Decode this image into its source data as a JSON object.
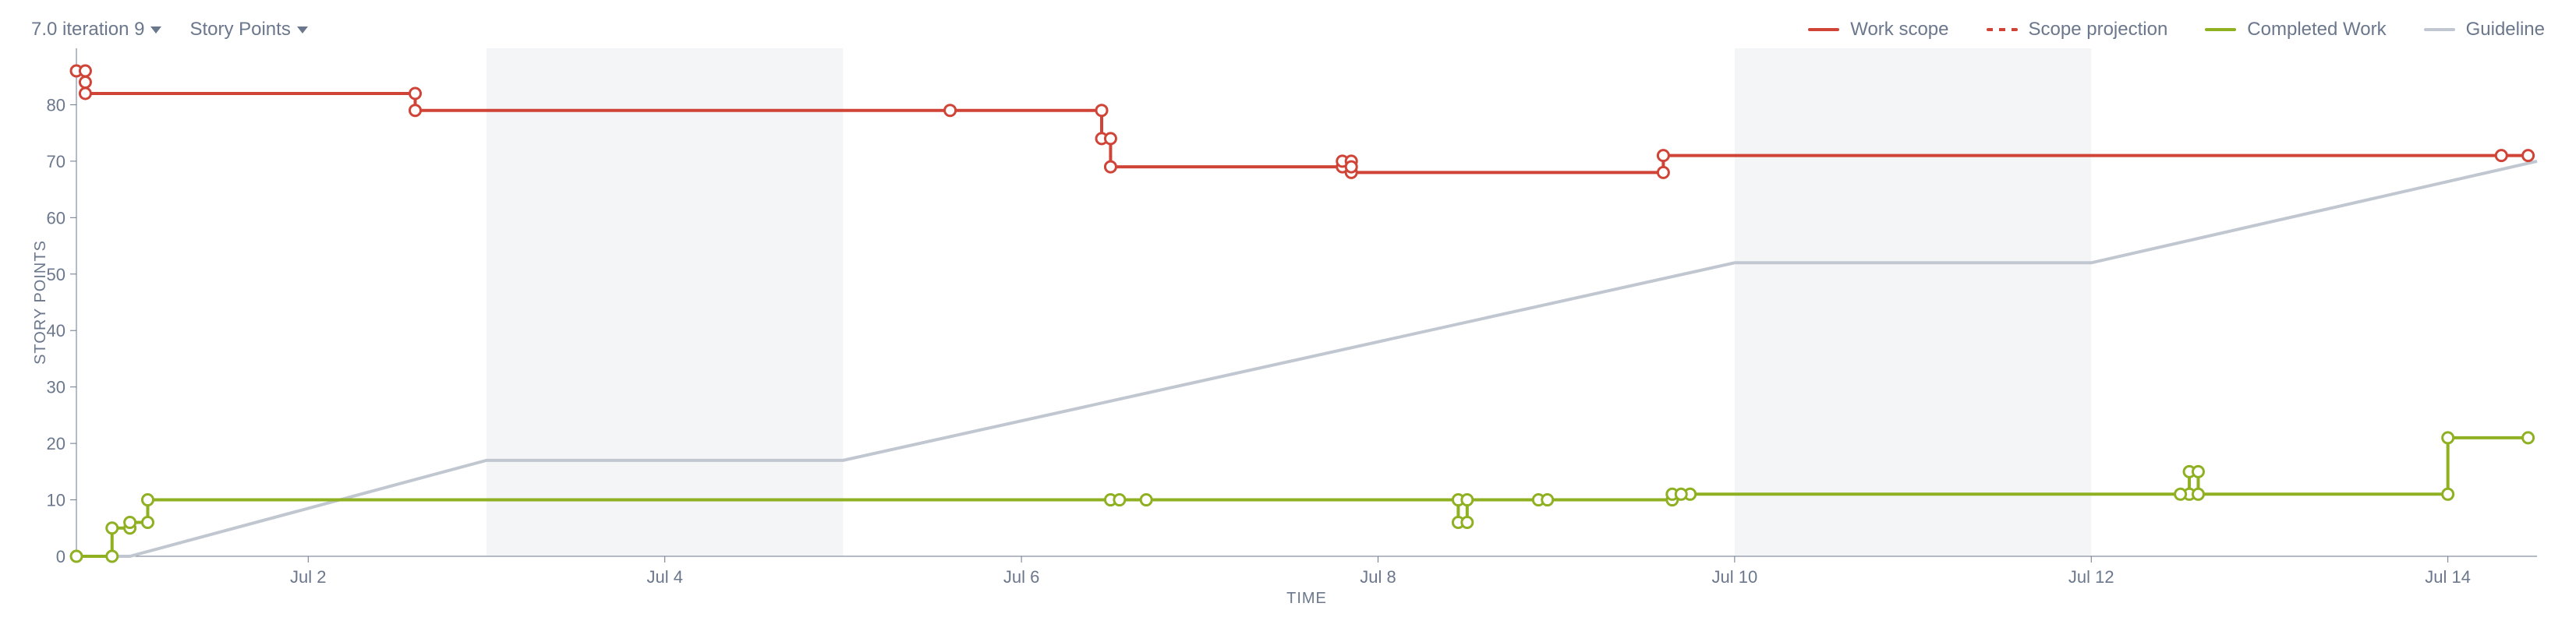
{
  "controls": {
    "sprint_dd_label": "7.0 iteration 9",
    "metric_dd_label": "Story Points"
  },
  "legend": {
    "work_scope": "Work scope",
    "scope_projection": "Scope projection",
    "completed_work": "Completed Work",
    "guideline": "Guideline"
  },
  "axes": {
    "x_title": "TIME",
    "y_title": "STORY POINTS"
  },
  "colors": {
    "red": "#d04437",
    "green": "#8eb021",
    "grey": "#c1c7d0",
    "weekend": "#f4f5f7",
    "text": "#6b778c"
  },
  "chart_data": {
    "type": "line",
    "xlabel": "TIME",
    "ylabel": "STORY POINTS",
    "ylim": [
      0,
      90
    ],
    "y_ticks": [
      0,
      10,
      20,
      30,
      40,
      50,
      60,
      70,
      80
    ],
    "x_range": [
      0.7,
      14.5
    ],
    "x_tick_positions": [
      2,
      4,
      6,
      8,
      10,
      12,
      14
    ],
    "x_tick_labels": [
      "Jul 2",
      "Jul 4",
      "Jul 6",
      "Jul 8",
      "Jul 10",
      "Jul 12",
      "Jul 14"
    ],
    "weekend_bands": [
      [
        3,
        5
      ],
      [
        10,
        12
      ]
    ],
    "series": [
      {
        "name": "Guideline",
        "style": "guideline",
        "markers": false,
        "points": [
          [
            0.7,
            0
          ],
          [
            1,
            0
          ],
          [
            3,
            17
          ],
          [
            5,
            17
          ],
          [
            10,
            52
          ],
          [
            12,
            52
          ],
          [
            14.5,
            70
          ]
        ]
      },
      {
        "name": "Work scope",
        "style": "red",
        "markers": true,
        "points": [
          [
            0.7,
            86
          ],
          [
            0.75,
            86
          ],
          [
            0.75,
            82
          ],
          [
            2.6,
            82
          ],
          [
            2.6,
            79
          ],
          [
            5.6,
            79
          ],
          [
            6.45,
            79
          ],
          [
            6.45,
            74
          ],
          [
            6.5,
            74
          ],
          [
            6.5,
            69
          ],
          [
            7.8,
            69
          ],
          [
            7.8,
            70
          ],
          [
            7.85,
            70
          ],
          [
            7.85,
            68
          ],
          [
            9.6,
            68
          ],
          [
            9.6,
            71
          ],
          [
            14.3,
            71
          ],
          [
            14.45,
            71
          ]
        ]
      },
      {
        "name": "Completed Work",
        "style": "green",
        "markers": true,
        "points": [
          [
            0.7,
            0
          ],
          [
            0.9,
            0
          ],
          [
            0.9,
            5
          ],
          [
            1.0,
            5
          ],
          [
            1.0,
            6
          ],
          [
            1.1,
            6
          ],
          [
            1.1,
            10
          ],
          [
            6.5,
            10
          ],
          [
            6.7,
            10
          ],
          [
            8.45,
            10
          ],
          [
            8.45,
            6
          ],
          [
            8.5,
            6
          ],
          [
            8.5,
            10
          ],
          [
            8.9,
            10
          ],
          [
            8.95,
            10
          ],
          [
            9.65,
            10
          ],
          [
            9.65,
            11
          ],
          [
            9.75,
            11
          ],
          [
            12.55,
            11
          ],
          [
            12.55,
            15
          ],
          [
            12.6,
            15
          ],
          [
            12.6,
            11
          ],
          [
            14.0,
            11
          ],
          [
            14.0,
            21
          ],
          [
            14.45,
            21
          ]
        ]
      }
    ],
    "extra_markers": {
      "red": [
        [
          0.75,
          84
        ],
        [
          7.85,
          69
        ]
      ],
      "green": [
        [
          6.55,
          10
        ],
        [
          9.7,
          11
        ],
        [
          12.5,
          11
        ]
      ]
    }
  }
}
